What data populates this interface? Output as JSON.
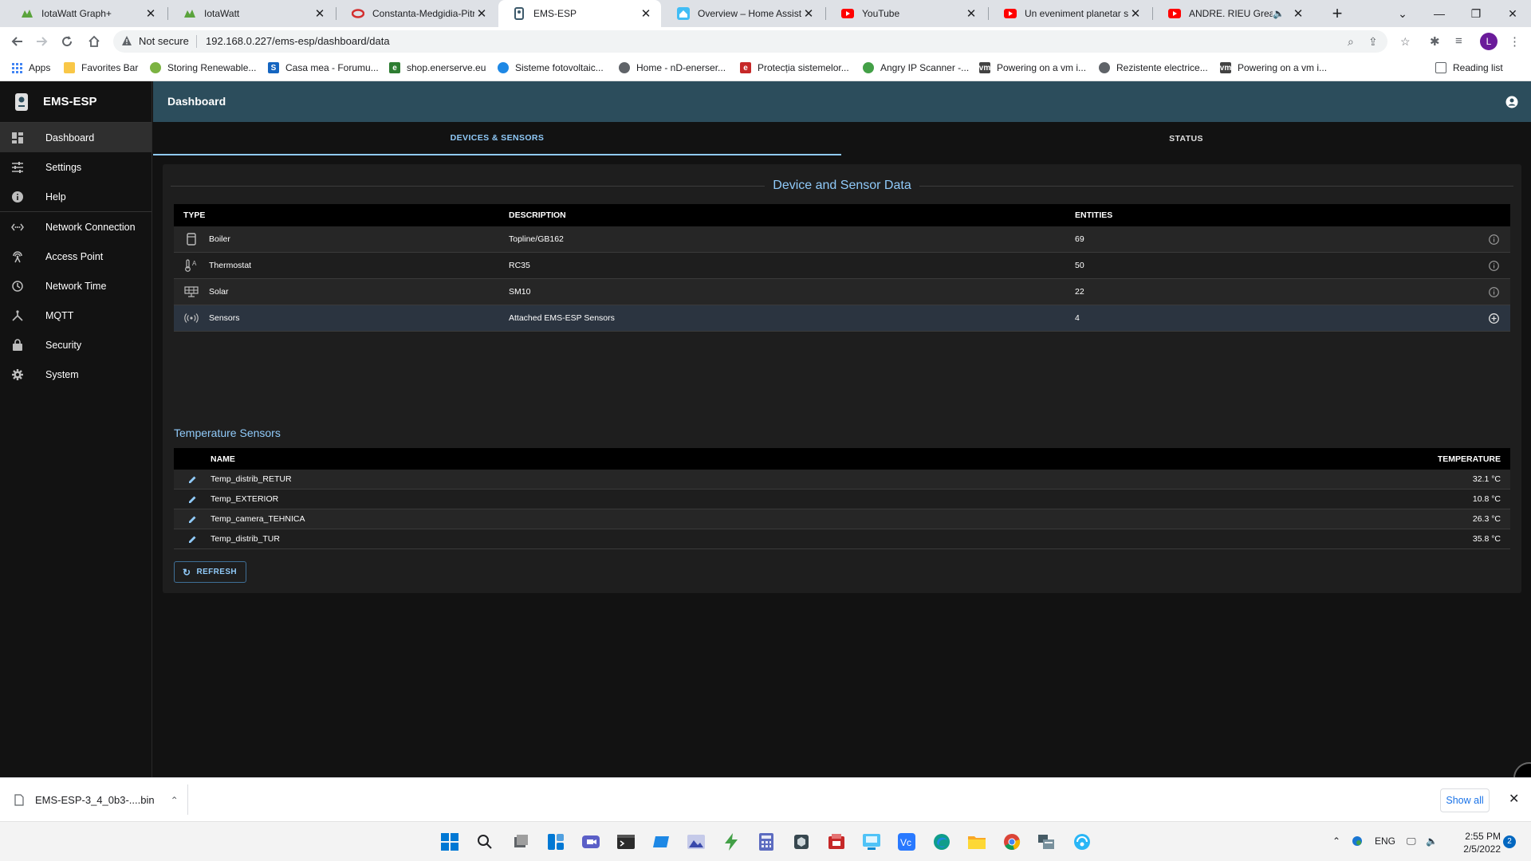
{
  "browser": {
    "tabs": [
      {
        "title": "IotaWatt Graph+",
        "icon": "iotawatt-icon",
        "color": "#5aa33c"
      },
      {
        "title": "IotaWatt",
        "icon": "iotawatt-icon",
        "color": "#5aa33c"
      },
      {
        "title": "Constanta-Medgidia-Pitra",
        "icon": "opera-icon",
        "color": "#d32f2f"
      },
      {
        "title": "EMS-ESP",
        "icon": "ems-icon",
        "color": "#3d5a6b",
        "active": true
      },
      {
        "title": "Overview – Home Assistan",
        "icon": "home-assistant-icon",
        "color": "#41bdf5"
      },
      {
        "title": "YouTube",
        "icon": "youtube-icon",
        "color": "#ff0000"
      },
      {
        "title": "Un eveniment planetar s-",
        "icon": "youtube-icon",
        "color": "#ff0000"
      },
      {
        "title": "ANDRE. RIEU Greatest",
        "icon": "youtube-icon",
        "color": "#ff0000",
        "muted": true
      }
    ],
    "new_tab_label": "+",
    "address": {
      "security_label": "Not secure",
      "url": "192.168.0.227/ems-esp/dashboard/data"
    },
    "bookmarks": [
      {
        "label": "Apps",
        "icon": "apps-grid-icon",
        "color": "#4285f4"
      },
      {
        "label": "Favorites Bar",
        "icon": "folder-icon",
        "color": "#f9c747"
      },
      {
        "label": "Storing Renewable...",
        "icon": "site-icon",
        "color": "#7cb342"
      },
      {
        "label": "Casa mea - Forumu...",
        "icon": "site-s-icon",
        "color": "#1565c0"
      },
      {
        "label": "shop.enerserve.eu",
        "icon": "site-e-icon",
        "color": "#2e7d32"
      },
      {
        "label": "Sisteme fotovoltaic...",
        "icon": "site-icon",
        "color": "#1e88e5"
      },
      {
        "label": "Home - nD-enerser...",
        "icon": "globe-icon",
        "color": "#5f6368"
      },
      {
        "label": "Protecția sistemelor...",
        "icon": "site-e-icon",
        "color": "#c62828"
      },
      {
        "label": "Angry IP Scanner -...",
        "icon": "site-icon",
        "color": "#43a047"
      },
      {
        "label": "Powering on a vm i...",
        "icon": "vmware-icon",
        "color": "#424242"
      },
      {
        "label": "Rezistente electrice...",
        "icon": "globe-icon",
        "color": "#5f6368"
      },
      {
        "label": "Powering on a vm i...",
        "icon": "vmware-icon",
        "color": "#424242"
      }
    ],
    "reading_list_label": "Reading list",
    "profile_initial": "L"
  },
  "sidebar": {
    "brand": "EMS-ESP",
    "items": [
      {
        "label": "Dashboard",
        "icon": "dashboard-icon",
        "active": true
      },
      {
        "label": "Settings",
        "icon": "settings-sliders-icon"
      },
      {
        "label": "Help",
        "icon": "info-icon"
      },
      {
        "label": "Network Connection",
        "icon": "network-icon"
      },
      {
        "label": "Access Point",
        "icon": "access-point-icon"
      },
      {
        "label": "Network Time",
        "icon": "clock-icon"
      },
      {
        "label": "MQTT",
        "icon": "mqtt-icon"
      },
      {
        "label": "Security",
        "icon": "lock-icon"
      },
      {
        "label": "System",
        "icon": "gear-icon"
      }
    ]
  },
  "header": {
    "title": "Dashboard"
  },
  "tabs": [
    {
      "label": "DEVICES & SENSORS",
      "selected": true
    },
    {
      "label": "STATUS",
      "selected": false
    }
  ],
  "devices": {
    "title": "Device and Sensor Data",
    "columns": [
      "TYPE",
      "DESCRIPTION",
      "ENTITIES"
    ],
    "rows": [
      {
        "type": "Boiler",
        "description": "Topline/GB162",
        "entities": "69",
        "icon": "boiler-icon",
        "action": "info-icon"
      },
      {
        "type": "Thermostat",
        "description": "RC35",
        "entities": "50",
        "icon": "thermostat-icon",
        "action": "info-icon"
      },
      {
        "type": "Solar",
        "description": "SM10",
        "entities": "22",
        "icon": "solar-icon",
        "action": "info-icon"
      },
      {
        "type": "Sensors",
        "description": "Attached EMS-ESP Sensors",
        "entities": "4",
        "icon": "sensors-icon",
        "action": "add-circle-icon"
      }
    ]
  },
  "sensors": {
    "title": "Temperature Sensors",
    "columns": [
      "NAME",
      "TEMPERATURE"
    ],
    "rows": [
      {
        "name": "Temp_distrib_RETUR",
        "temperature": "32.1 °C"
      },
      {
        "name": "Temp_EXTERIOR",
        "temperature": "10.8 °C"
      },
      {
        "name": "Temp_camera_TEHNICA",
        "temperature": "26.3 °C"
      },
      {
        "name": "Temp_distrib_TUR",
        "temperature": "35.8 °C"
      }
    ]
  },
  "refresh_label": "REFRESH",
  "downloads": {
    "file_name": "EMS-ESP-3_4_0b3-....bin",
    "show_all_label": "Show all"
  },
  "taskbar": {
    "language": "ENG",
    "time": "2:55 PM",
    "date": "2/5/2022",
    "notification_count": "2",
    "apps": [
      "windows-start-icon",
      "search-icon",
      "task-view-icon",
      "widgets-icon",
      "teams-icon",
      "terminal-icon",
      "app-icon",
      "photos-icon",
      "app-icon",
      "calculator-icon",
      "app-icon",
      "app-icon",
      "app-icon",
      "vscode-icon",
      "edge-icon",
      "file-explorer-icon",
      "chrome-icon",
      "app-icon",
      "app-icon"
    ]
  },
  "colors": {
    "accent": "#90caf9",
    "appbar": "#2c4d5c",
    "background": "#121212",
    "panel": "#1e1e1e"
  }
}
